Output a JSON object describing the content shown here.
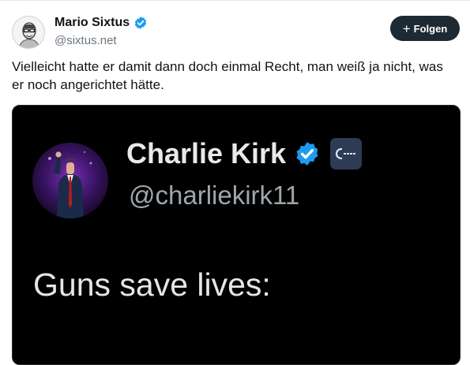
{
  "author": {
    "name": "Mario Sixtus",
    "handle": "@sixtus.net",
    "verified_color": "#1d9bf0"
  },
  "follow_button": {
    "icon": "plus-icon",
    "label": "Folgen"
  },
  "post": {
    "text": "Vielleicht hatte er damit dann doch einmal Recht, man weiß ja nicht, was er noch angerichtet hätte."
  },
  "embedded_media": {
    "name": "Charlie Kirk",
    "handle": "@charliekirk11",
    "badge_icon": "affiliate-badge-icon",
    "text": "Guns save lives:"
  },
  "colors": {
    "follow_button_bg": "#1d2a34",
    "media_bg": "#000000",
    "verified": "#1d9bf0"
  }
}
